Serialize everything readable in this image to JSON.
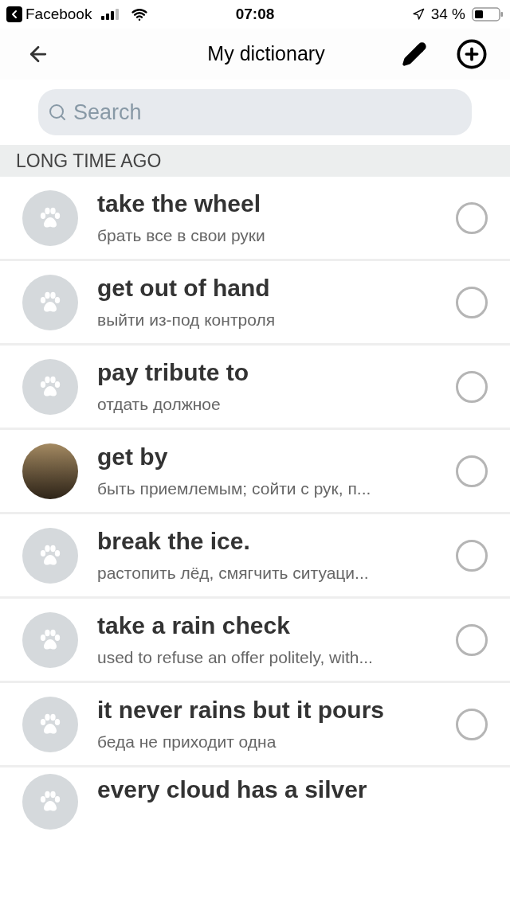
{
  "status_bar": {
    "back_app": "Facebook",
    "time": "07:08",
    "battery": "34 %"
  },
  "header": {
    "title": "My dictionary"
  },
  "search": {
    "placeholder": "Search"
  },
  "section": {
    "title": "LONG TIME AGO"
  },
  "entries": [
    {
      "phrase": "take the wheel",
      "meaning": "брать все в свои руки",
      "kind": "paw",
      "checked": false
    },
    {
      "phrase": "get out of hand",
      "meaning": "выйти из-под контроля",
      "kind": "paw",
      "checked": false
    },
    {
      "phrase": "pay tribute to",
      "meaning": "отдать должное",
      "kind": "paw",
      "checked": false
    },
    {
      "phrase": "get by",
      "meaning": "быть приемлемым; сойти с рук, п...",
      "kind": "photo",
      "checked": false
    },
    {
      "phrase": "break the ice.",
      "meaning": "растопить лёд, смягчить ситуаци...",
      "kind": "paw",
      "checked": false
    },
    {
      "phrase": "take a rain check",
      "meaning": "used to refuse an offer politely, with...",
      "kind": "paw",
      "checked": false
    },
    {
      "phrase": "it never rains but it pours",
      "meaning": "беда не приходит одна",
      "kind": "paw",
      "checked": false
    },
    {
      "phrase": "every cloud has a silver",
      "kind": "paw"
    }
  ]
}
